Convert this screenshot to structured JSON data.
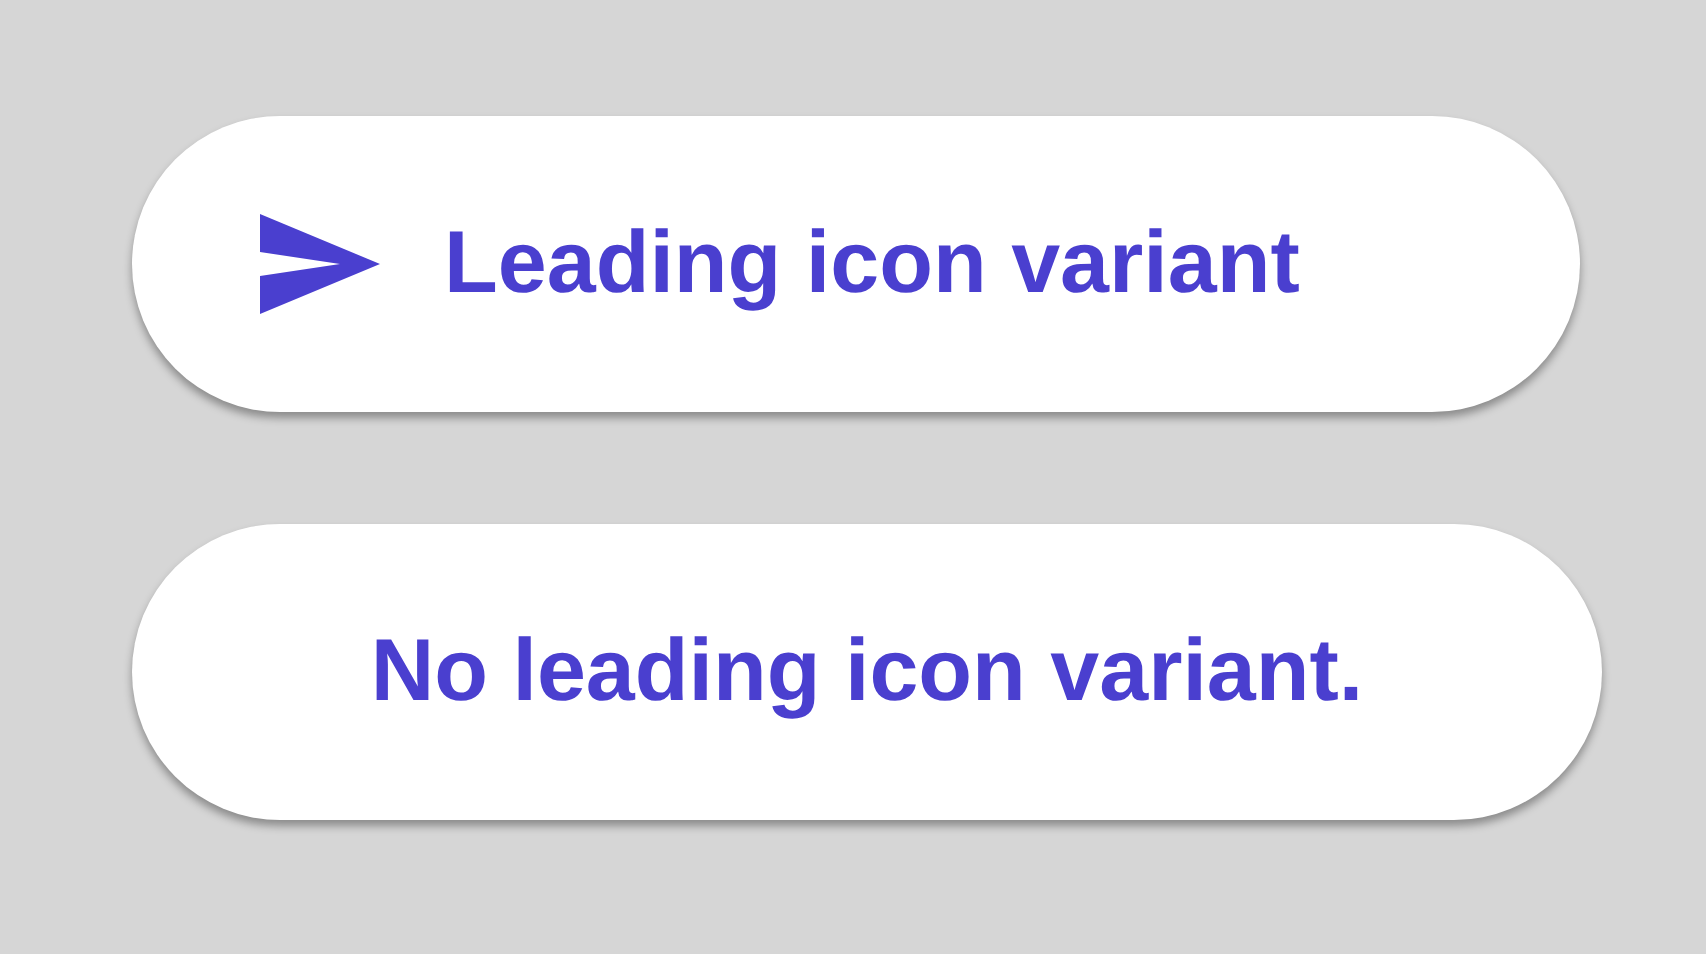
{
  "buttons": [
    {
      "kind": "leading-icon",
      "label": "Leading icon variant"
    },
    {
      "kind": "plain",
      "label": "No leading icon variant."
    }
  ]
}
